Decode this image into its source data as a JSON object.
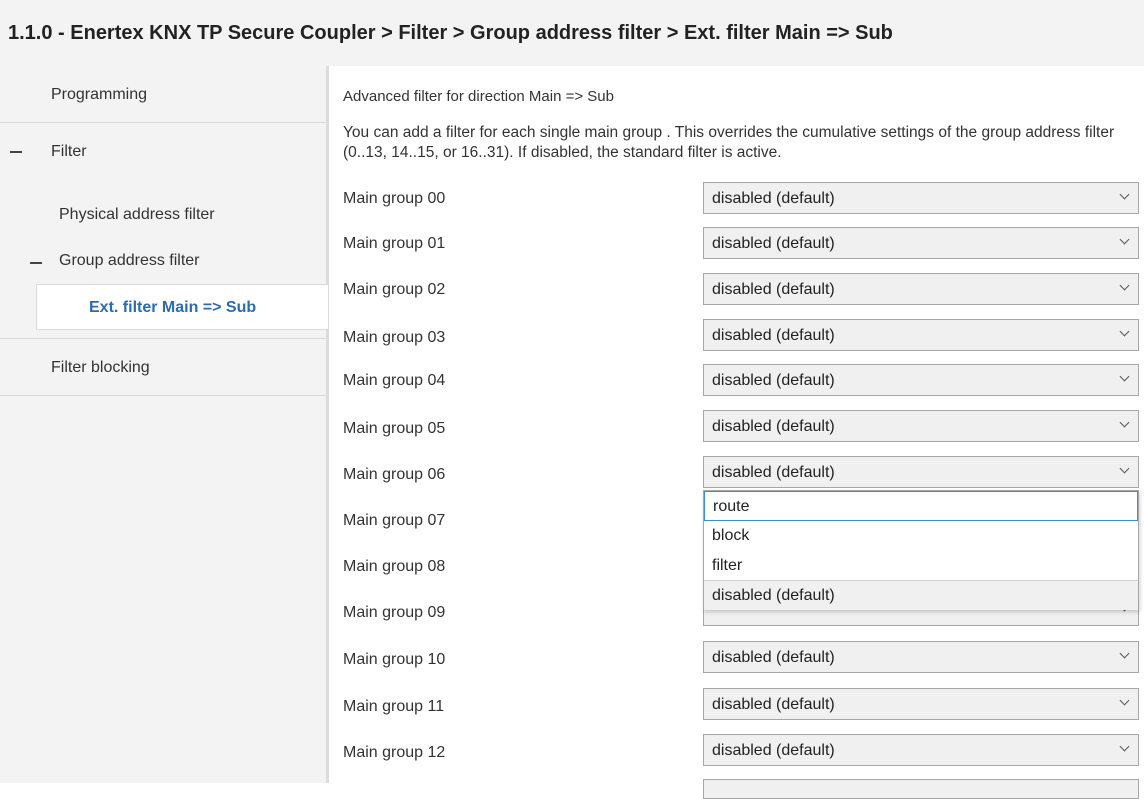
{
  "title": "1.1.0 - Enertex KNX TP Secure Coupler > Filter > Group address filter > Ext. filter Main => Sub",
  "sidebar": {
    "programming": "Programming",
    "filter": "Filter",
    "physical_address_filter": "Physical address filter",
    "group_address_filter": "Group address filter",
    "ext_filter": "Ext. filter Main => Sub",
    "filter_blocking": "Filter blocking"
  },
  "main": {
    "heading": "Advanced filter for direction Main => Sub",
    "description": "You can add a filter for each single main group . This overrides the cumulative settings of the group address filter (0..13, 14..15, or 16..31). If disabled, the standard filter is active.",
    "rows": [
      {
        "label": "Main group 00",
        "value": "disabled (default)"
      },
      {
        "label": "Main group 01",
        "value": "disabled (default)"
      },
      {
        "label": "Main group 02",
        "value": "disabled (default)"
      },
      {
        "label": "Main group 03",
        "value": "disabled (default)"
      },
      {
        "label": "Main group 04",
        "value": "disabled (default)"
      },
      {
        "label": "Main group 05",
        "value": "disabled (default)"
      },
      {
        "label": "Main group 06",
        "value": "disabled (default)"
      },
      {
        "label": "Main group 07",
        "value": ""
      },
      {
        "label": "Main group 08",
        "value": ""
      },
      {
        "label": "Main group 09",
        "value": ""
      },
      {
        "label": "Main group 10",
        "value": "disabled (default)"
      },
      {
        "label": "Main group 11",
        "value": "disabled (default)"
      },
      {
        "label": "Main group 12",
        "value": "disabled (default)"
      }
    ],
    "dropdown_options": [
      "route",
      "block",
      "filter",
      "disabled (default)"
    ]
  }
}
